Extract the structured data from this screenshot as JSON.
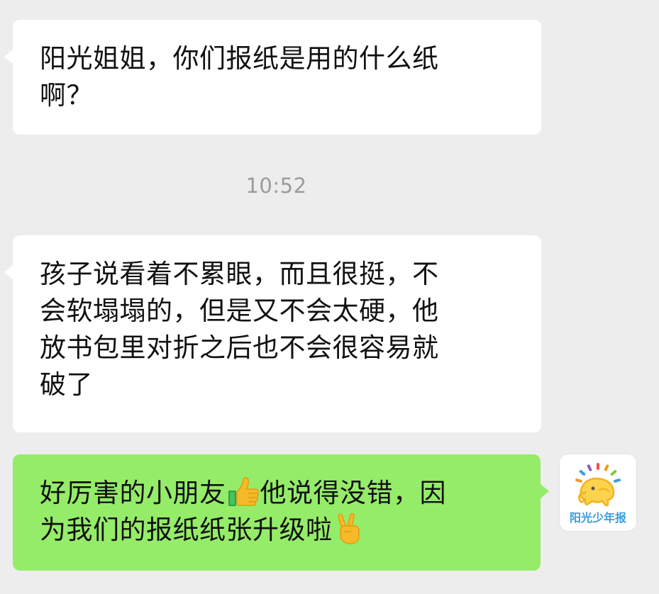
{
  "messages": [
    {
      "side": "incoming",
      "text": "阳光姐姐，你们报纸是用的什么纸\n啊？"
    },
    {
      "side": "incoming",
      "text": "孩子说看着不累眼，而且很挺，不\n会软塌塌的，但是又不会太硬，他\n放书包里对折之后也不会很容易就\n破了"
    },
    {
      "side": "outgoing",
      "part1": "好厉害的小朋友",
      "emoji1": "thumbs-up-icon",
      "part2": "他说得没错，因\n为我们的报纸纸张升级啦",
      "emoji2": "victory-hand-icon"
    }
  ],
  "timestamp": "10:52",
  "avatar": {
    "name": "阳光少年报",
    "icon": "sun-elephant-logo"
  },
  "colors": {
    "background": "#ededed",
    "incoming_bubble": "#ffffff",
    "outgoing_bubble": "#95ec69",
    "timestamp": "#9b9b9b",
    "brand": "#3a9fd8"
  }
}
